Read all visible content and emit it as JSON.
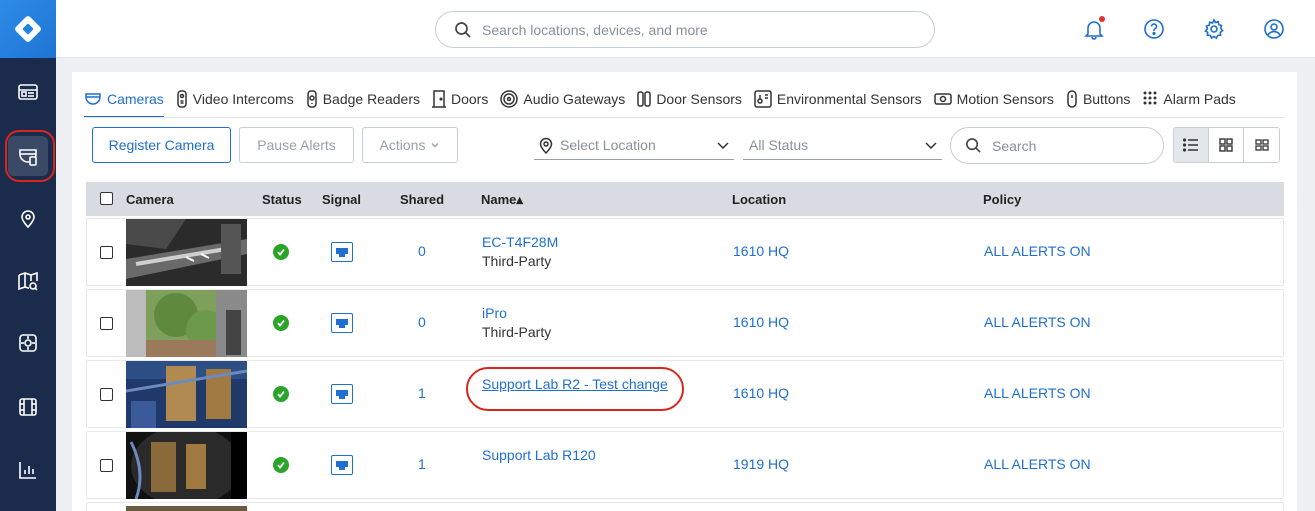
{
  "search": {
    "placeholder": "Search locations, devices, and more"
  },
  "sidebar": {
    "items": [
      {
        "name": "dashboard",
        "icon": "dashboard-icon"
      },
      {
        "name": "devices",
        "icon": "camera-devices-icon",
        "active": true
      },
      {
        "name": "locations",
        "icon": "location-pin-icon"
      },
      {
        "name": "maps",
        "icon": "map-search-icon"
      },
      {
        "name": "alarms",
        "icon": "alarm-panel-icon"
      },
      {
        "name": "footage",
        "icon": "film-icon"
      },
      {
        "name": "reports",
        "icon": "bar-chart-icon"
      }
    ]
  },
  "tabs": [
    {
      "label": "Cameras",
      "icon": "camera-icon",
      "active": true
    },
    {
      "label": "Video Intercoms",
      "icon": "intercom-icon"
    },
    {
      "label": "Badge Readers",
      "icon": "badge-reader-icon"
    },
    {
      "label": "Doors",
      "icon": "door-icon"
    },
    {
      "label": "Audio Gateways",
      "icon": "audio-gateway-icon"
    },
    {
      "label": "Door Sensors",
      "icon": "door-sensor-icon"
    },
    {
      "label": "Environmental Sensors",
      "icon": "environmental-sensor-icon"
    },
    {
      "label": "Motion Sensors",
      "icon": "motion-sensor-icon"
    },
    {
      "label": "Buttons",
      "icon": "button-icon"
    },
    {
      "label": "Alarm Pads",
      "icon": "alarm-pad-icon"
    }
  ],
  "toolbar": {
    "register_label": "Register Camera",
    "pause_label": "Pause Alerts",
    "actions_label": "Actions",
    "location_placeholder": "Select Location",
    "status_value": "All Status",
    "search_placeholder": "Search"
  },
  "table": {
    "headers": {
      "camera": "Camera",
      "status": "Status",
      "signal": "Signal",
      "shared": "Shared",
      "name": "Name▴",
      "location": "Location",
      "policy": "Policy"
    },
    "rows": [
      {
        "shared": "0",
        "name": "EC-T4F28M",
        "subtitle": "Third-Party",
        "location": "1610 HQ",
        "policy": "ALL ALERTS ON",
        "status": "online"
      },
      {
        "shared": "0",
        "name": "iPro",
        "subtitle": "Third-Party",
        "location": "1610 HQ",
        "policy": "ALL ALERTS ON",
        "status": "online"
      },
      {
        "shared": "1",
        "name": "Support Lab R2 - Test change",
        "subtitle": "",
        "location": "1610 HQ",
        "policy": "ALL ALERTS ON",
        "status": "online"
      },
      {
        "shared": "1",
        "name": "Support Lab R120",
        "subtitle": "",
        "location": "1919 HQ",
        "policy": "ALL ALERTS ON",
        "status": "online"
      }
    ]
  },
  "colors": {
    "accent": "#1f6fd1",
    "sidebar": "#1b2b4b",
    "success": "#2aa52a",
    "highlight": "#d9261c"
  }
}
